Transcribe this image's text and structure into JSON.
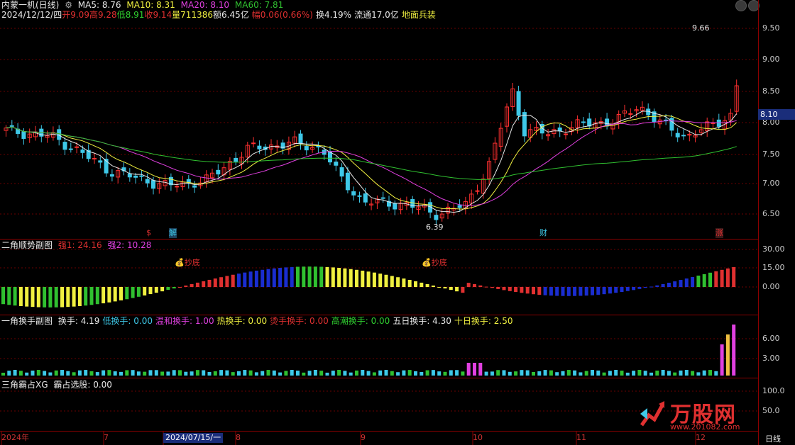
{
  "header": {
    "title": "内蒙一机(日线)",
    "ma5": "MA5: 8.76",
    "ma10": "MA10: 8.31",
    "ma20": "MA20: 8.10",
    "ma60": "MA60: 7.81",
    "date": "2024/12/12/四",
    "open_label": "开",
    "open": "9.09",
    "high_label": "高",
    "high": "9.28",
    "low_label": "低",
    "low": "8.91",
    "close_label": "收",
    "close": "9.14",
    "vol_label": "量",
    "vol": "711386",
    "amt_label": "额",
    "amt": "6.45亿",
    "chg_label": "幅",
    "chg": "0.06(0.66%)",
    "turnover": "换4.19%",
    "float": "流通17.0亿",
    "concept": "地面兵装"
  },
  "price_axis": [
    "9.50",
    "9.00",
    "8.50",
    "8.00",
    "7.50",
    "7.00",
    "6.50"
  ],
  "current_price": "8.10",
  "annotations": {
    "high_mark": "9.66",
    "low_mark": "6.39"
  },
  "event_markers": [
    {
      "text": "$",
      "color": "#e03030"
    },
    {
      "text": "解",
      "color": "#3ec8e8"
    },
    {
      "text": "财",
      "color": "#3ec8e8"
    },
    {
      "text": "涨",
      "color": "#e03030"
    }
  ],
  "panel2": {
    "title": "二角顺势副图",
    "s1": "强1: 24.16",
    "s2": "强2: 10.28",
    "axis": [
      "30.00",
      "15.00",
      "0.00"
    ],
    "bottom_label_1": "抄底",
    "bottom_label_2": "抄底"
  },
  "panel3": {
    "title": "一角换手副图",
    "items": [
      {
        "label": "换手: 4.19",
        "color": "#e8e8e8"
      },
      {
        "label": "低换手: 0.00",
        "color": "#3ec8e8"
      },
      {
        "label": "温和换手: 1.00",
        "color": "#e040e0"
      },
      {
        "label": "热换手: 0.00",
        "color": "#f0f040"
      },
      {
        "label": "烫手换手: 0.00",
        "color": "#e03030"
      },
      {
        "label": "高潮换手: 0.00",
        "color": "#30d030"
      },
      {
        "label": "五日换手: 4.30",
        "color": "#e8e8e8"
      },
      {
        "label": "十日换手: 2.50",
        "color": "#f0f040"
      }
    ],
    "axis": [
      "6.00",
      "3.00"
    ]
  },
  "panel4": {
    "title": "三角霸占XG",
    "value": "霸占选股: 0.00",
    "axis": [
      "100.0",
      "50.0"
    ]
  },
  "x_axis": {
    "labels": [
      "2024年",
      "7",
      "2024/07/15/一",
      "8",
      "9",
      "10",
      "11",
      "12"
    ],
    "period": "日线"
  },
  "watermark": {
    "text": "万股网",
    "url": "www.201082.com"
  },
  "colors": {
    "up": "#ff3030",
    "down": "#3ec8e8",
    "ma5": "#e8e8e8",
    "ma10": "#f0f040",
    "ma20": "#e040e0",
    "ma60": "#30c030"
  }
}
